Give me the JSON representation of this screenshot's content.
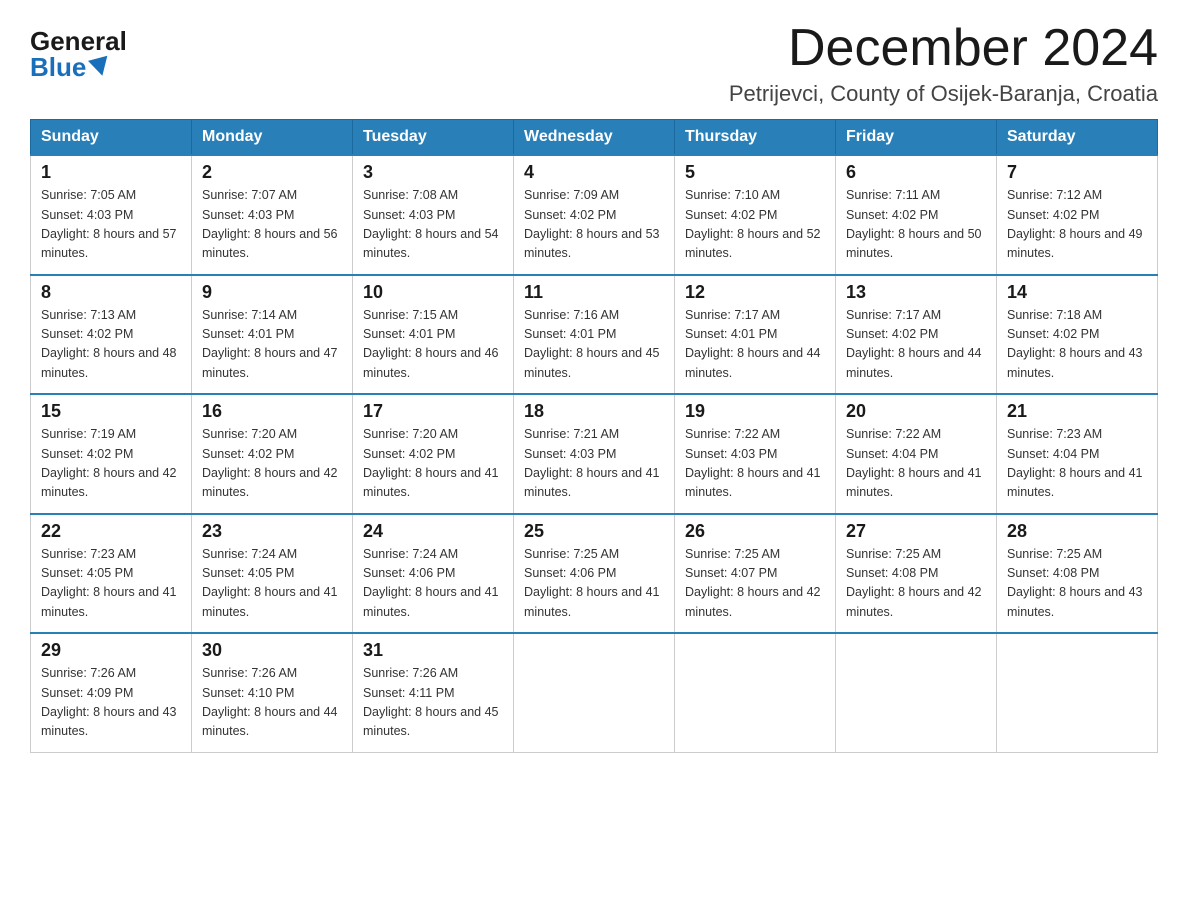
{
  "logo": {
    "general": "General",
    "blue": "Blue"
  },
  "title": {
    "month_year": "December 2024",
    "location": "Petrijevci, County of Osijek-Baranja, Croatia"
  },
  "headers": [
    "Sunday",
    "Monday",
    "Tuesday",
    "Wednesday",
    "Thursday",
    "Friday",
    "Saturday"
  ],
  "weeks": [
    [
      {
        "day": "1",
        "sunrise": "7:05 AM",
        "sunset": "4:03 PM",
        "daylight": "8 hours and 57 minutes."
      },
      {
        "day": "2",
        "sunrise": "7:07 AM",
        "sunset": "4:03 PM",
        "daylight": "8 hours and 56 minutes."
      },
      {
        "day": "3",
        "sunrise": "7:08 AM",
        "sunset": "4:03 PM",
        "daylight": "8 hours and 54 minutes."
      },
      {
        "day": "4",
        "sunrise": "7:09 AM",
        "sunset": "4:02 PM",
        "daylight": "8 hours and 53 minutes."
      },
      {
        "day": "5",
        "sunrise": "7:10 AM",
        "sunset": "4:02 PM",
        "daylight": "8 hours and 52 minutes."
      },
      {
        "day": "6",
        "sunrise": "7:11 AM",
        "sunset": "4:02 PM",
        "daylight": "8 hours and 50 minutes."
      },
      {
        "day": "7",
        "sunrise": "7:12 AM",
        "sunset": "4:02 PM",
        "daylight": "8 hours and 49 minutes."
      }
    ],
    [
      {
        "day": "8",
        "sunrise": "7:13 AM",
        "sunset": "4:02 PM",
        "daylight": "8 hours and 48 minutes."
      },
      {
        "day": "9",
        "sunrise": "7:14 AM",
        "sunset": "4:01 PM",
        "daylight": "8 hours and 47 minutes."
      },
      {
        "day": "10",
        "sunrise": "7:15 AM",
        "sunset": "4:01 PM",
        "daylight": "8 hours and 46 minutes."
      },
      {
        "day": "11",
        "sunrise": "7:16 AM",
        "sunset": "4:01 PM",
        "daylight": "8 hours and 45 minutes."
      },
      {
        "day": "12",
        "sunrise": "7:17 AM",
        "sunset": "4:01 PM",
        "daylight": "8 hours and 44 minutes."
      },
      {
        "day": "13",
        "sunrise": "7:17 AM",
        "sunset": "4:02 PM",
        "daylight": "8 hours and 44 minutes."
      },
      {
        "day": "14",
        "sunrise": "7:18 AM",
        "sunset": "4:02 PM",
        "daylight": "8 hours and 43 minutes."
      }
    ],
    [
      {
        "day": "15",
        "sunrise": "7:19 AM",
        "sunset": "4:02 PM",
        "daylight": "8 hours and 42 minutes."
      },
      {
        "day": "16",
        "sunrise": "7:20 AM",
        "sunset": "4:02 PM",
        "daylight": "8 hours and 42 minutes."
      },
      {
        "day": "17",
        "sunrise": "7:20 AM",
        "sunset": "4:02 PM",
        "daylight": "8 hours and 41 minutes."
      },
      {
        "day": "18",
        "sunrise": "7:21 AM",
        "sunset": "4:03 PM",
        "daylight": "8 hours and 41 minutes."
      },
      {
        "day": "19",
        "sunrise": "7:22 AM",
        "sunset": "4:03 PM",
        "daylight": "8 hours and 41 minutes."
      },
      {
        "day": "20",
        "sunrise": "7:22 AM",
        "sunset": "4:04 PM",
        "daylight": "8 hours and 41 minutes."
      },
      {
        "day": "21",
        "sunrise": "7:23 AM",
        "sunset": "4:04 PM",
        "daylight": "8 hours and 41 minutes."
      }
    ],
    [
      {
        "day": "22",
        "sunrise": "7:23 AM",
        "sunset": "4:05 PM",
        "daylight": "8 hours and 41 minutes."
      },
      {
        "day": "23",
        "sunrise": "7:24 AM",
        "sunset": "4:05 PM",
        "daylight": "8 hours and 41 minutes."
      },
      {
        "day": "24",
        "sunrise": "7:24 AM",
        "sunset": "4:06 PM",
        "daylight": "8 hours and 41 minutes."
      },
      {
        "day": "25",
        "sunrise": "7:25 AM",
        "sunset": "4:06 PM",
        "daylight": "8 hours and 41 minutes."
      },
      {
        "day": "26",
        "sunrise": "7:25 AM",
        "sunset": "4:07 PM",
        "daylight": "8 hours and 42 minutes."
      },
      {
        "day": "27",
        "sunrise": "7:25 AM",
        "sunset": "4:08 PM",
        "daylight": "8 hours and 42 minutes."
      },
      {
        "day": "28",
        "sunrise": "7:25 AM",
        "sunset": "4:08 PM",
        "daylight": "8 hours and 43 minutes."
      }
    ],
    [
      {
        "day": "29",
        "sunrise": "7:26 AM",
        "sunset": "4:09 PM",
        "daylight": "8 hours and 43 minutes."
      },
      {
        "day": "30",
        "sunrise": "7:26 AM",
        "sunset": "4:10 PM",
        "daylight": "8 hours and 44 minutes."
      },
      {
        "day": "31",
        "sunrise": "7:26 AM",
        "sunset": "4:11 PM",
        "daylight": "8 hours and 45 minutes."
      },
      null,
      null,
      null,
      null
    ]
  ]
}
